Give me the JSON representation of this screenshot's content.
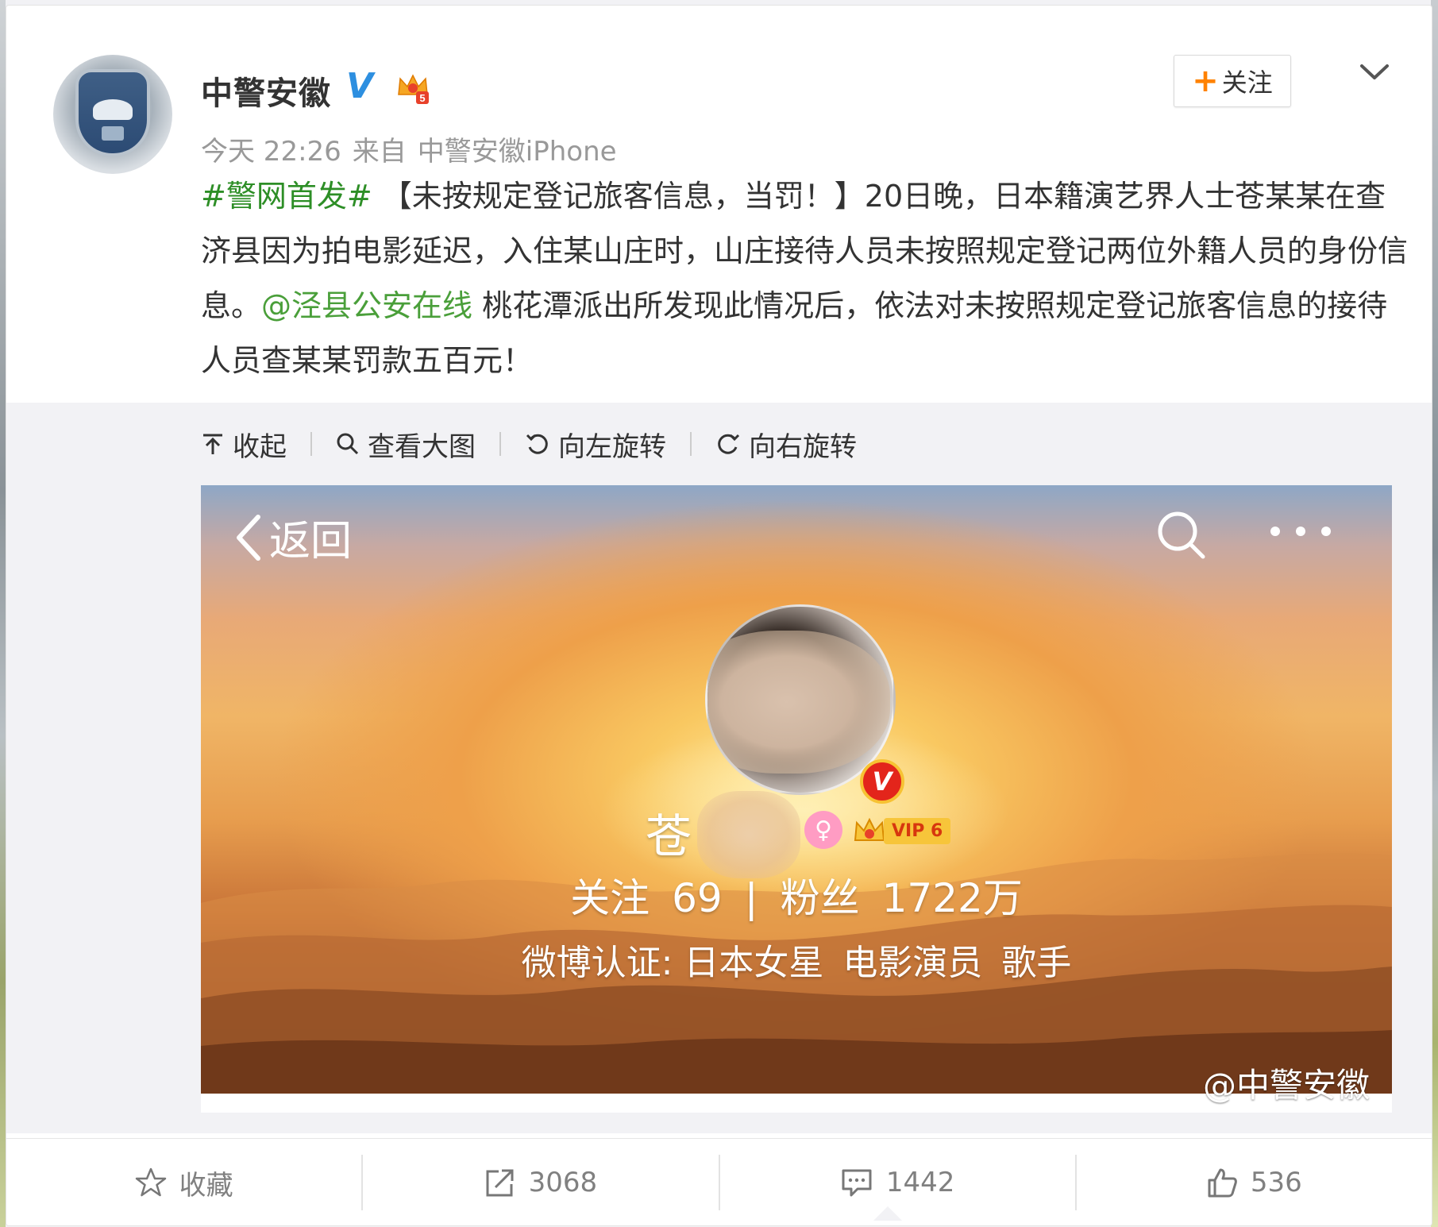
{
  "author": {
    "name": "中警安徽",
    "verified_mark": "V",
    "vip_level_badge": "5"
  },
  "meta": {
    "time": "今天 22:26",
    "from_label": "来自",
    "source": "中警安徽iPhone"
  },
  "follow_button": {
    "plus": "+",
    "label": "关注"
  },
  "post": {
    "hashtag": "#警网首发#",
    "body_1": " 【未按规定登记旅客信息，当罚！】20日晚，日本籍演艺界人士苍某某在查济县因为拍电影延迟，入住某山庄时，山庄接待人员未按照规定登记两位外籍人员的身份信息。",
    "mention": "@泾县公安在线",
    "body_2": " 桃花潭派出所发现此情况后，依法对未按照规定登记旅客信息的接待人员查某某罚款五百元！"
  },
  "image_toolbar": {
    "collapse": "收起",
    "view_large": "查看大图",
    "rotate_left": "向左旋转",
    "rotate_right": "向右旋转"
  },
  "embedded_screenshot": {
    "back_label": "返回",
    "profile_name_visible": "苍",
    "v_badge": "V",
    "gender_symbol": "♀",
    "vip_label": "VIP 6",
    "following_label": "关注",
    "following_count": "69",
    "stats_divider": "|",
    "fans_label": "粉丝",
    "fans_count": "1722万",
    "cert_label": "微博认证: 日本女星",
    "cert_role_1": "电影演员",
    "cert_role_2": "歌手",
    "watermark": "@中警安徽"
  },
  "actions": {
    "favorite": "收藏",
    "repost_count": "3068",
    "comment_count": "1442",
    "like_count": "536"
  },
  "colors": {
    "topic_green": "#2d8e26",
    "follow_orange": "#ff8200",
    "verify_blue": "#2d8fe0"
  }
}
